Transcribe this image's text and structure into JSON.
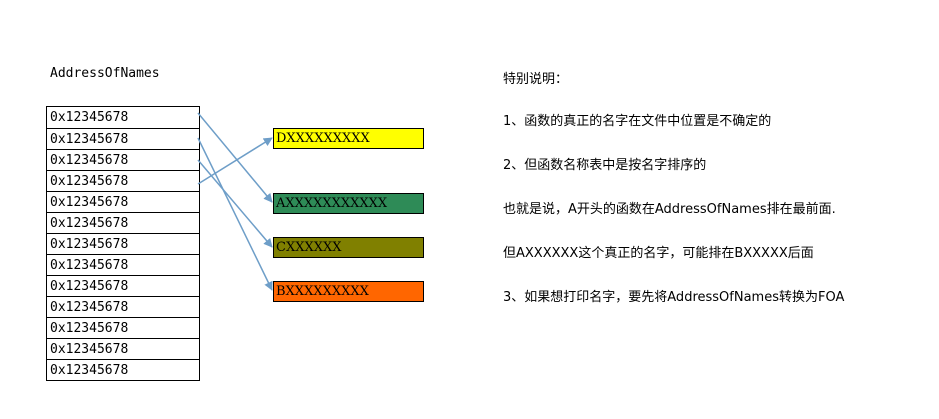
{
  "table": {
    "title": "AddressOfNames",
    "rows": [
      "0x12345678",
      "0x12345678",
      "0x12345678",
      "0x12345678",
      "0x12345678",
      "0x12345678",
      "0x12345678",
      "0x12345678",
      "0x12345678",
      "0x12345678",
      "0x12345678",
      "0x12345678",
      "0x12345678"
    ]
  },
  "names": [
    {
      "label": "DXXXXXXXXX",
      "color": "#ffff00"
    },
    {
      "label": "AXXXXXXXXXXX",
      "color": "#2e8b57"
    },
    {
      "label": "CXXXXXX",
      "color": "#808000"
    },
    {
      "label": "BXXXXXXXXX",
      "color": "#ff6600"
    }
  ],
  "arrow_color": "#6e9ec8",
  "notes": {
    "heading": "特别说明：",
    "items": [
      "1、函数的真正的名字在文件中位置是不确定的",
      "2、但函数名称表中是按名字排序的",
      "也就是说，A开头的函数在AddressOfNames排在最前面.",
      "但AXXXXXX这个真正的名字，可能排在BXXXXX后面",
      "3、如果想打印名字，要先将AddressOfNames转换为FOA"
    ]
  }
}
